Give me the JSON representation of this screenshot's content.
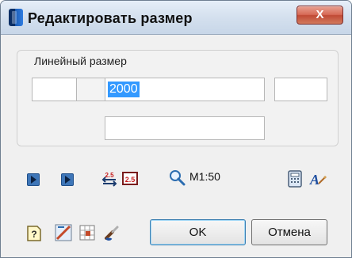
{
  "window": {
    "title": "Редактировать размер",
    "close_label": "X"
  },
  "group": {
    "label": "Линейный размер",
    "fields": {
      "prefix": "",
      "prefix2": "",
      "main_value": "2000",
      "suffix": "",
      "bottom": ""
    }
  },
  "toolbar": {
    "scale_label": "M1:50",
    "icons": [
      "arrow-right-icon",
      "arrow-right-icon",
      "swap-values-icon",
      "text-2-5-icon",
      "zoom-icon",
      "calculator-icon",
      "style-icon"
    ]
  },
  "bottom_toolbar": {
    "icons": [
      "help-icon",
      "measure-icon",
      "table-icon",
      "brush-icon"
    ]
  },
  "buttons": {
    "ok": "OK",
    "cancel": "Отмена"
  }
}
